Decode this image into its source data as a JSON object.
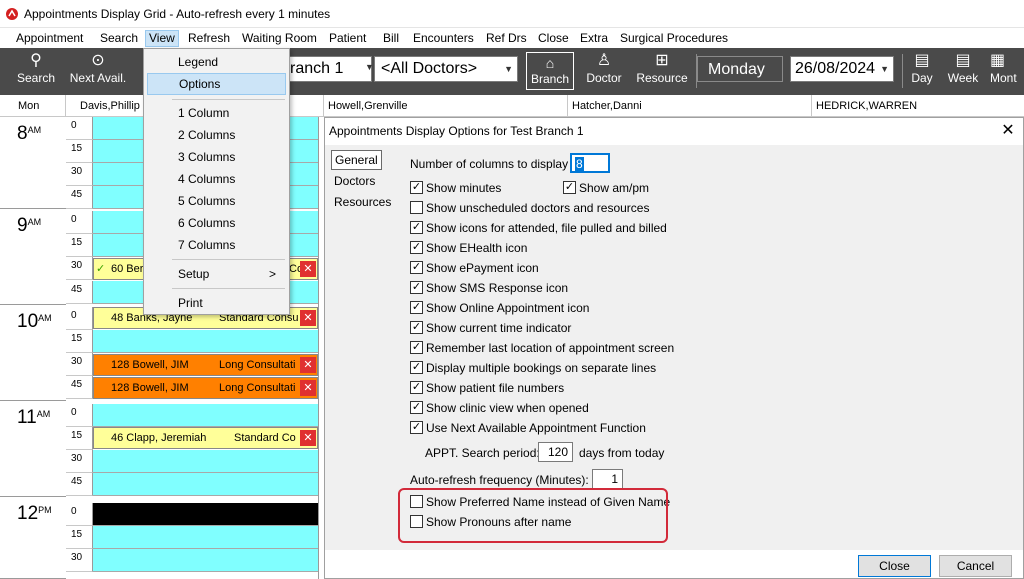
{
  "window": {
    "title": "Appointments Display Grid - Auto-refresh every 1 minutes"
  },
  "menubar": [
    "Appointment",
    "Search",
    "View",
    "Refresh",
    "Waiting Room",
    "Patient",
    "Bill",
    "Encounters",
    "Ref Drs",
    "Close",
    "Extra",
    "Surgical Procedures"
  ],
  "toolbar": {
    "search_label": "Search",
    "next_avail_label": "Next Avail.",
    "branch_value": "ranch 1",
    "doctor_value": "<All Doctors>",
    "branch_btn": "Branch",
    "doctor_btn": "Doctor",
    "resource_btn": "Resource",
    "day_name": "Monday",
    "date_value": "26/08/2024",
    "day_btn": "Day",
    "week_btn": "Week",
    "month_btn": "Mont"
  },
  "grid_header": {
    "day": "Mon",
    "doctors": [
      "Davis,Phillip",
      "Howell,Grenville",
      "Hatcher,Danni",
      "HEDRICK,WARREN"
    ]
  },
  "hours": [
    {
      "hour": "8",
      "suffix": "AM"
    },
    {
      "hour": "9",
      "suffix": "AM"
    },
    {
      "hour": "10",
      "suffix": "AM"
    },
    {
      "hour": "11",
      "suffix": "AM"
    },
    {
      "hour": "12",
      "suffix": "PM"
    }
  ],
  "minutes": [
    "0",
    "15",
    "30",
    "45"
  ],
  "appointments": [
    {
      "name": "60 Ber",
      "type": "Co",
      "tick": "✓"
    },
    {
      "name": "48 Banks, Jayne",
      "type": "Standard Consu"
    },
    {
      "name": "128 Bowell, JIM",
      "type": "Long Consultati"
    },
    {
      "name": "128 Bowell, JIM",
      "type": "Long Consultati"
    },
    {
      "name": "46 Clapp, Jeremiah",
      "type": "Standard Co"
    }
  ],
  "view_menu": {
    "items": [
      "Legend",
      "Options",
      "1 Column",
      "2 Columns",
      "3 Columns",
      "4 Columns",
      "5 Columns",
      "6 Columns",
      "7 Columns",
      "Setup",
      "Print"
    ],
    "setup_arrow": ">"
  },
  "dialog": {
    "title": "Appointments Display Options for Test Branch 1",
    "close_glyph": "✕",
    "tabs": [
      "General",
      "Doctors",
      "Resources"
    ],
    "num_columns_label": "Number of columns to display",
    "num_columns_value": "8",
    "show_minutes": "Show minutes",
    "show_ampm": "Show am/pm",
    "options": [
      {
        "label": "Show unscheduled doctors and resources",
        "checked": false
      },
      {
        "label": "Show icons for attended, file pulled and billed",
        "checked": true
      },
      {
        "label": "Show EHealth icon",
        "checked": true
      },
      {
        "label": "Show ePayment icon",
        "checked": true
      },
      {
        "label": "Show SMS Response icon",
        "checked": true
      },
      {
        "label": "Show Online Appointment icon",
        "checked": true
      },
      {
        "label": "Show current time indicator",
        "checked": true
      },
      {
        "label": "Remember last location of appointment screen",
        "checked": true
      },
      {
        "label": "Display multiple bookings on separate lines",
        "checked": true
      },
      {
        "label": "Show patient file numbers",
        "checked": true
      },
      {
        "label": "Show clinic view when opened",
        "checked": true
      },
      {
        "label": "Use Next Available Appointment Function",
        "checked": true
      }
    ],
    "appt_search_label": "APPT. Search period:",
    "appt_search_value": "120",
    "appt_search_suffix": "days from today",
    "autorefresh_label": "Auto-refresh frequency (Minutes):",
    "autorefresh_value": "1",
    "preferred_name": "Show Preferred Name instead of Given Name",
    "pronouns": "Show Pronouns after name",
    "close_btn": "Close",
    "cancel_btn": "Cancel",
    "checkmark": "✓"
  },
  "colors": {
    "free_slot": "#80ffff",
    "standard_appt": "#ffff99",
    "long_appt": "#ff8000",
    "highlight": "#d22a3a"
  }
}
